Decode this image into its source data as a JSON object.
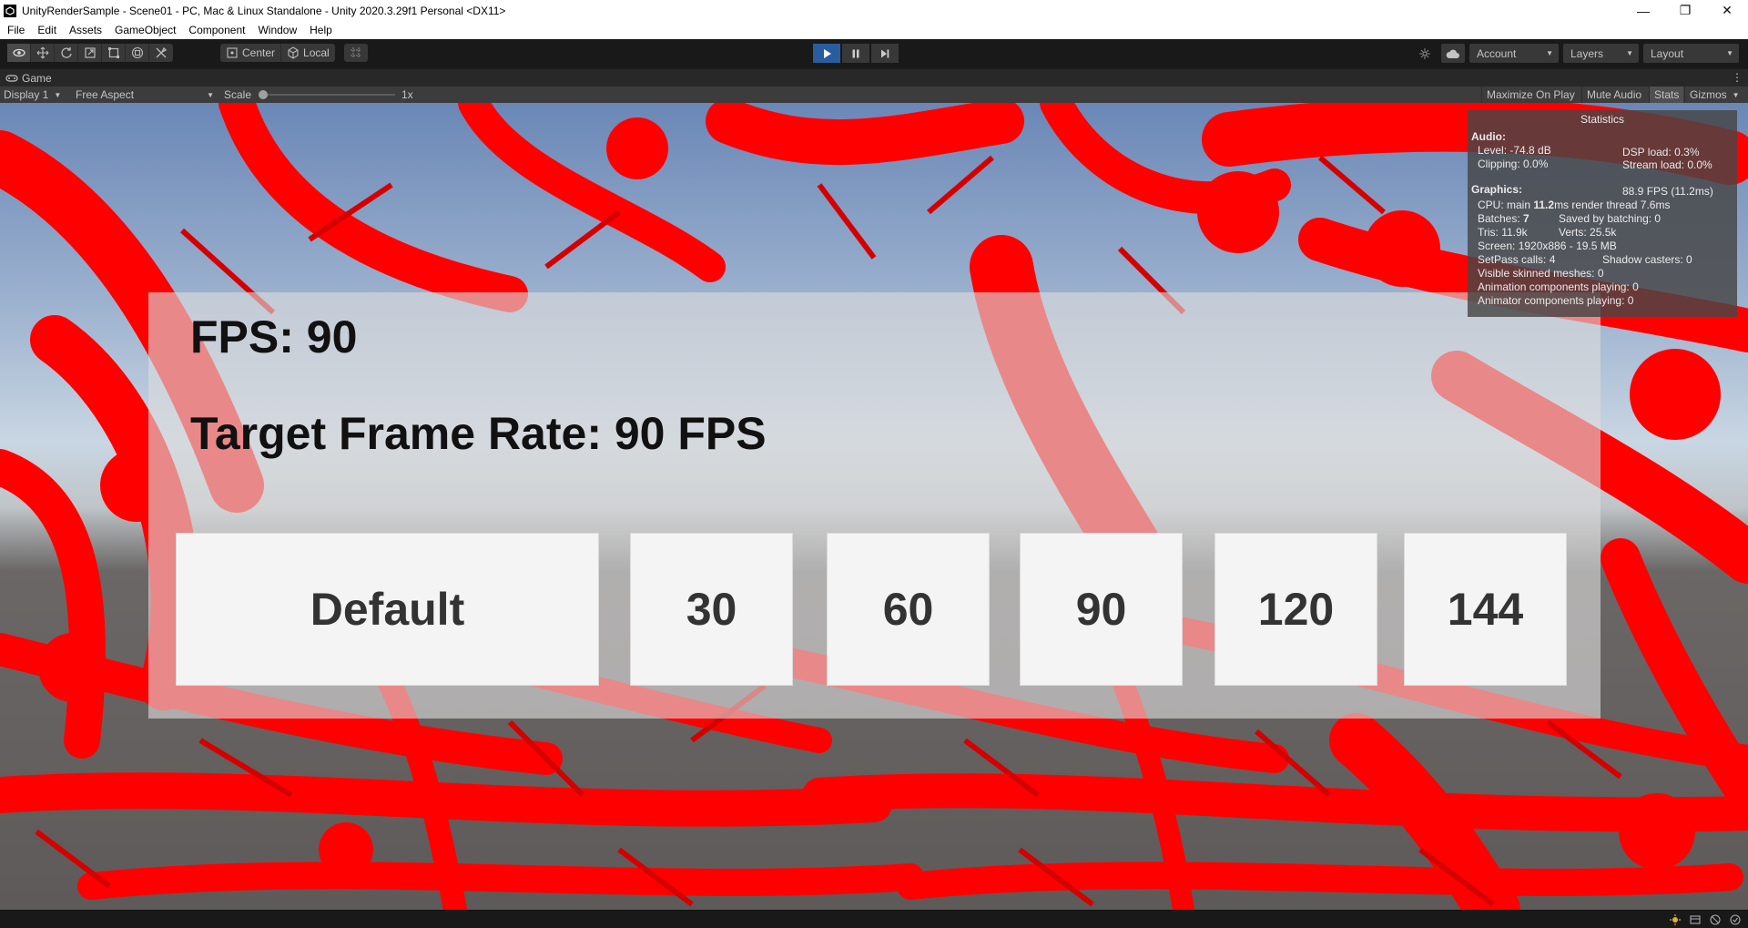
{
  "window": {
    "title": "UnityRenderSample - Scene01 - PC, Mac & Linux Standalone - Unity 2020.3.29f1 Personal <DX11>",
    "minimize": "—",
    "maximize": "❐",
    "close": "✕"
  },
  "menu": [
    "File",
    "Edit",
    "Assets",
    "GameObject",
    "Component",
    "Window",
    "Help"
  ],
  "toolbar": {
    "pivot_center": "Center",
    "pivot_local": "Local",
    "account": "Account",
    "layers": "Layers",
    "layout": "Layout"
  },
  "game_tab": {
    "label": "Game",
    "display": "Display 1",
    "aspect": "Free Aspect",
    "scale_label": "Scale",
    "scale_value": "1x",
    "maximize_on_play": "Maximize On Play",
    "mute_audio": "Mute Audio",
    "stats": "Stats",
    "gizmos": "Gizmos"
  },
  "game_ui": {
    "fps_text": "FPS: 90",
    "target_text": "Target Frame Rate: 90 FPS",
    "buttons": [
      "Default",
      "30",
      "60",
      "90",
      "120",
      "144"
    ]
  },
  "statistics": {
    "title": "Statistics",
    "audio_header": "Audio:",
    "level": "Level: -74.8 dB",
    "clipping": "Clipping: 0.0%",
    "dsp_load": "DSP load: 0.3%",
    "stream_load": "Stream load: 0.0%",
    "graphics_header": "Graphics:",
    "fps": "88.9 FPS (11.2ms)",
    "cpu_prefix": "CPU: main ",
    "cpu_main": "11.2",
    "cpu_suffix": "ms  render thread 7.6ms",
    "batches_prefix": "Batches: ",
    "batches": "7",
    "saved_by_batching": "Saved by batching: 0",
    "tris": "Tris: 11.9k",
    "verts": "Verts: 25.5k",
    "screen": "Screen: 1920x886 - 19.5 MB",
    "setpass": "SetPass calls: 4",
    "shadow_casters": "Shadow casters: 0",
    "skinned": "Visible skinned meshes: 0",
    "anim": "Animation components playing: 0",
    "animator": "Animator components playing: 0"
  },
  "colors": {
    "scene_red": "#ff0000",
    "play_active": "#2a5d9f",
    "panel": "#dcdcdc"
  }
}
